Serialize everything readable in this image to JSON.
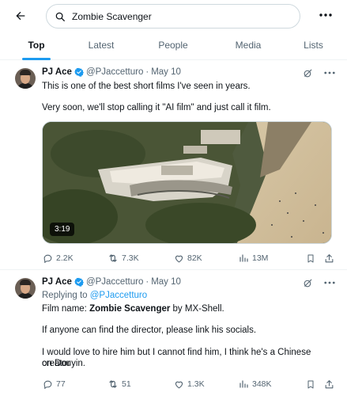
{
  "search": {
    "query": "Zombie Scavenger"
  },
  "tabs": [
    {
      "label": "Top"
    },
    {
      "label": "Latest"
    },
    {
      "label": "People"
    },
    {
      "label": "Media"
    },
    {
      "label": "Lists"
    }
  ],
  "tweets": [
    {
      "name": "PJ Ace",
      "handle": "@PJaccetturo",
      "dot": "·",
      "date": "May 10",
      "lines": [
        "This is one of the best short films I've seen in years.",
        "Very soon, we'll stop calling it \"AI film\" and just call it film."
      ],
      "video_duration": "3:19",
      "stats": {
        "replies": "2.2K",
        "reposts": "7.3K",
        "likes": "82K",
        "views": "13M"
      }
    },
    {
      "name": "PJ Ace",
      "handle": "@PJaccetturo",
      "dot": "·",
      "date": "May 10",
      "replying_prefix": "Replying to ",
      "replying_to": "@PJaccetturo",
      "film_prefix": "Film name: ",
      "film_title": "Zombie Scavenger",
      "film_suffix": " by MX-Shell.",
      "line3": "If anyone can find the director, please link his socials.",
      "line4": "I would love to hire him but I cannot find him, I think he's a Chinese creator",
      "line5": "on Douyin.",
      "stats": {
        "replies": "77",
        "reposts": "51",
        "likes": "1.3K",
        "views": "348K"
      }
    }
  ],
  "colors": {
    "accent": "#1d9bf0",
    "text": "#0f1419",
    "muted": "#536471",
    "border": "#eff3f4"
  },
  "icons": [
    "back-arrow-icon",
    "search-icon",
    "more-icon",
    "verified-badge-icon",
    "grok-icon",
    "reply-icon",
    "repost-icon",
    "like-icon",
    "views-icon",
    "bookmark-icon",
    "share-icon"
  ]
}
